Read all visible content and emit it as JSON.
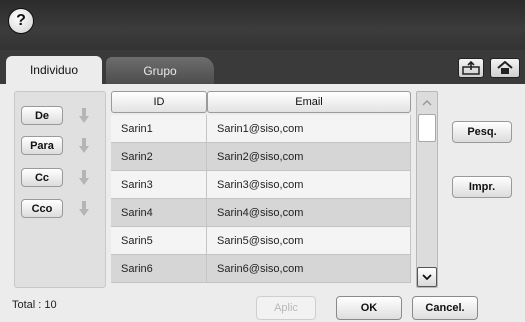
{
  "help": {
    "icon": "help-icon",
    "glyph": "?"
  },
  "tabs": [
    {
      "label": "Individuo",
      "active": true
    },
    {
      "label": "Grupo",
      "active": false
    }
  ],
  "toolbar": {
    "upload_icon": "upload-icon",
    "home_icon": "home-icon"
  },
  "recipients": [
    {
      "label": "De"
    },
    {
      "label": "Para"
    },
    {
      "label": "Cc"
    },
    {
      "label": "Cco"
    }
  ],
  "table": {
    "headers": {
      "id": "ID",
      "email": "Email"
    },
    "rows": [
      {
        "id": "Sarin1",
        "email": "Sarin1@siso,com"
      },
      {
        "id": "Sarin2",
        "email": "Sarin2@siso,com"
      },
      {
        "id": "Sarin3",
        "email": "Sarin3@siso,com"
      },
      {
        "id": "Sarin4",
        "email": "Sarin4@siso,com"
      },
      {
        "id": "Sarin5",
        "email": "Sarin5@siso,com"
      },
      {
        "id": "Sarin6",
        "email": "Sarin6@siso,com"
      }
    ]
  },
  "side_buttons": {
    "search": "Pesq.",
    "print": "Impr."
  },
  "footer": {
    "total": "Total : 10",
    "apply": "Aplic",
    "ok": "OK",
    "cancel": "Cancel."
  },
  "colors": {
    "topbar": "#333333",
    "panel": "#ececec",
    "disabled_text": "#b8b8b8"
  }
}
